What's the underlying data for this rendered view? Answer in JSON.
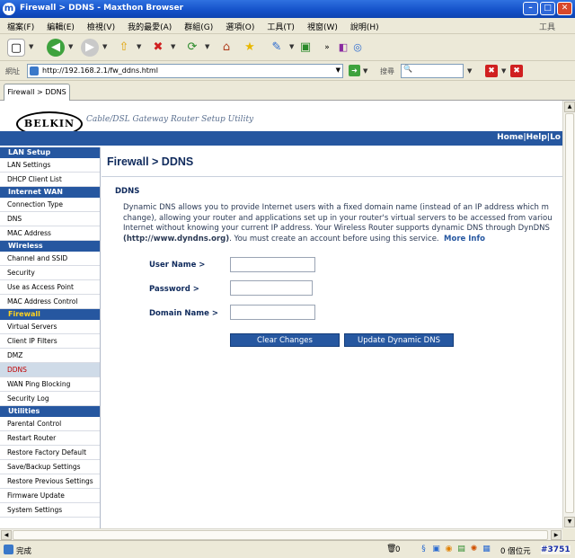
{
  "window": {
    "title": "Firewall > DDNS - Maxthon Browser",
    "app_icon": "m"
  },
  "menu": {
    "items": [
      "檔案(F)",
      "編輯(E)",
      "檢視(V)",
      "我的最愛(A)",
      "群組(G)",
      "選項(O)",
      "工具(T)",
      "視窗(W)",
      "說明(H)"
    ],
    "tools_label": "工具"
  },
  "address": {
    "label": "網址",
    "url": "http://192.168.2.1/fw_ddns.html",
    "search_label": "搜尋"
  },
  "tabs": [
    {
      "label": "Firewall > DDNS"
    }
  ],
  "header": {
    "logo": "BELKIN",
    "tagline": "Cable/DSL Gateway Router Setup Utility",
    "links": "Home|Help|Lo"
  },
  "sidebar": {
    "sections": [
      {
        "title": "LAN Setup",
        "active": false,
        "items": [
          "LAN Settings",
          "DHCP Client List"
        ]
      },
      {
        "title": "Internet WAN",
        "active": false,
        "items": [
          "Connection Type",
          "DNS",
          "MAC Address"
        ]
      },
      {
        "title": "Wireless",
        "active": false,
        "items": [
          "Channel and SSID",
          "Security",
          "Use as Access Point",
          "MAC Address Control"
        ]
      },
      {
        "title": "Firewall",
        "active": true,
        "items": [
          "Virtual Servers",
          "Client IP Filters",
          "DMZ",
          "DDNS",
          "WAN Ping Blocking",
          "Security Log"
        ]
      },
      {
        "title": "Utilities",
        "active": false,
        "items": [
          "Parental Control",
          "Restart Router",
          "Restore Factory Default",
          "Save/Backup Settings",
          "Restore Previous Settings",
          "Firmware Update",
          "System Settings"
        ]
      }
    ],
    "selected_item": "DDNS"
  },
  "content": {
    "page_title": "Firewall > DDNS",
    "section_title": "DDNS",
    "description_lines": [
      "Dynamic DNS allows you to provide Internet users with a fixed domain name (instead of an IP address which m",
      "change), allowing your router and applications set up in your router's virtual servers to be accessed from variou",
      "Internet without knowing your current IP address. Your Wireless Router supports dynamic DNS through DynDNS"
    ],
    "desc_link": "(http://www.dyndns.org)",
    "desc_tail": ". You must create an account before using this service.",
    "more_info": "More Info",
    "form": {
      "username_label": "User Name >",
      "password_label": "Password >",
      "domain_label": "Domain Name >",
      "username_value": "",
      "password_value": "",
      "domain_value": ""
    },
    "buttons": {
      "clear": "Clear Changes",
      "update": "Update Dynamic DNS"
    }
  },
  "status": {
    "text": "完成",
    "count": "0",
    "blocked": "0 個位元",
    "badge": "#3751"
  }
}
